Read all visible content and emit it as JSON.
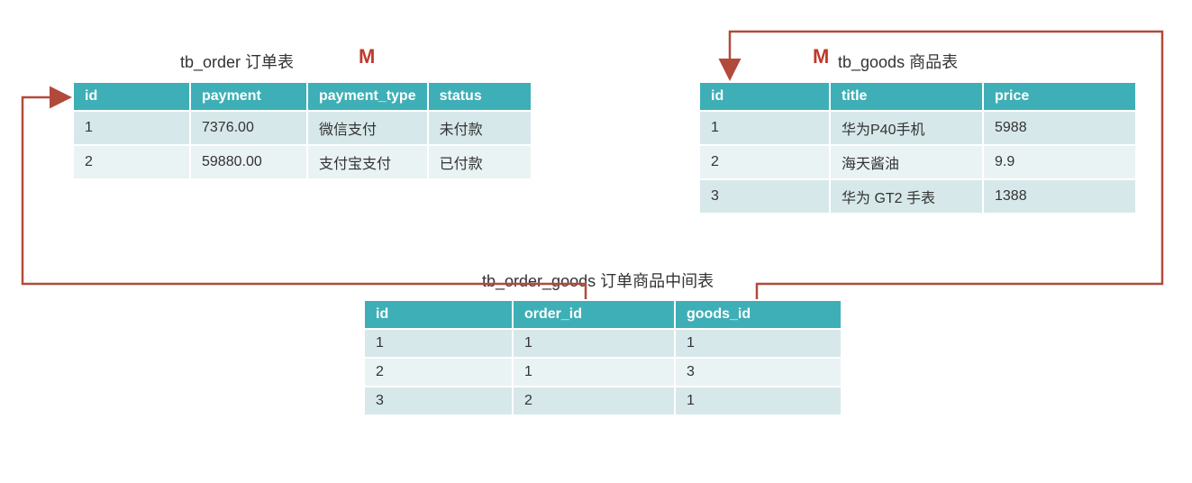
{
  "order": {
    "title": "tb_order 订单表",
    "m": "M",
    "headers": [
      "id",
      "payment",
      "payment_type",
      "status"
    ],
    "rows": [
      [
        "1",
        "7376.00",
        "微信支付",
        "未付款"
      ],
      [
        "2",
        "59880.00",
        "支付宝支付",
        "已付款"
      ]
    ]
  },
  "goods": {
    "title": "tb_goods 商品表",
    "m": "M",
    "headers": [
      "id",
      "title",
      "price"
    ],
    "rows": [
      [
        "1",
        "华为P40手机",
        "5988"
      ],
      [
        "2",
        "海天酱油",
        "9.9"
      ],
      [
        "3",
        "华为 GT2 手表",
        "1388"
      ]
    ]
  },
  "mid": {
    "title": "tb_order_goods 订单商品中间表",
    "headers": [
      "id",
      "order_id",
      "goods_id"
    ],
    "rows": [
      [
        "1",
        "1",
        "1"
      ],
      [
        "2",
        "1",
        "3"
      ],
      [
        "3",
        "2",
        "1"
      ]
    ]
  },
  "chart_data": {
    "type": "table",
    "title": "Database ER diagram: many-to-many between tb_order and tb_goods via tb_order_goods",
    "tables": [
      {
        "name": "tb_order",
        "label": "订单表",
        "columns": [
          "id",
          "payment",
          "payment_type",
          "status"
        ],
        "rows": [
          {
            "id": 1,
            "payment": 7376.0,
            "payment_type": "微信支付",
            "status": "未付款"
          },
          {
            "id": 2,
            "payment": 59880.0,
            "payment_type": "支付宝支付",
            "status": "已付款"
          }
        ]
      },
      {
        "name": "tb_goods",
        "label": "商品表",
        "columns": [
          "id",
          "title",
          "price"
        ],
        "rows": [
          {
            "id": 1,
            "title": "华为P40手机",
            "price": 5988
          },
          {
            "id": 2,
            "title": "海天酱油",
            "price": 9.9
          },
          {
            "id": 3,
            "title": "华为 GT2 手表",
            "price": 1388
          }
        ]
      },
      {
        "name": "tb_order_goods",
        "label": "订单商品中间表",
        "columns": [
          "id",
          "order_id",
          "goods_id"
        ],
        "rows": [
          {
            "id": 1,
            "order_id": 1,
            "goods_id": 1
          },
          {
            "id": 2,
            "order_id": 1,
            "goods_id": 3
          },
          {
            "id": 3,
            "order_id": 2,
            "goods_id": 1
          }
        ]
      }
    ],
    "relationships": [
      {
        "from": "tb_order_goods.order_id",
        "to": "tb_order.id",
        "cardinality": "M"
      },
      {
        "from": "tb_order_goods.goods_id",
        "to": "tb_goods.id",
        "cardinality": "M"
      }
    ]
  }
}
